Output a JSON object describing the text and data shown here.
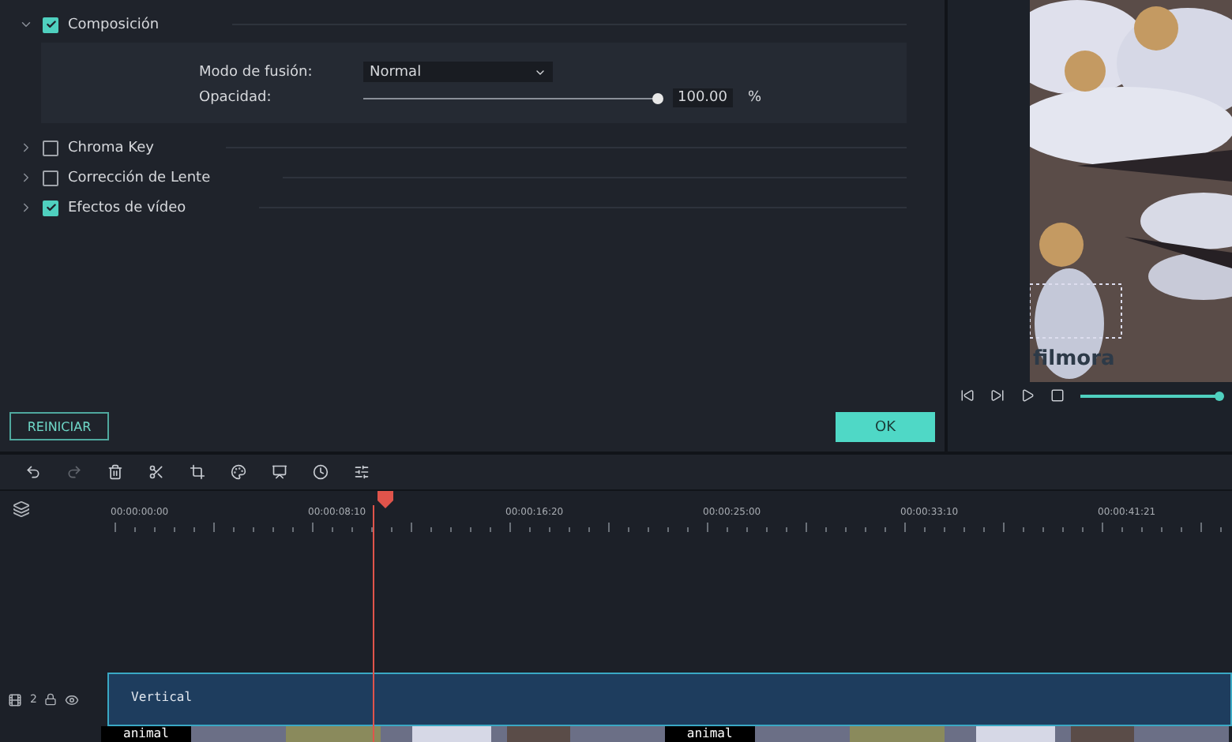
{
  "effects": [
    {
      "label": "Composición",
      "checked": true,
      "expanded": true
    },
    {
      "label": "Chroma Key",
      "checked": false,
      "expanded": false
    },
    {
      "label": "Corrección de Lente",
      "checked": false,
      "expanded": false
    },
    {
      "label": "Efectos de vídeo",
      "checked": true,
      "expanded": false
    }
  ],
  "composition": {
    "blend_label": "Modo de fusión:",
    "blend_value": "Normal",
    "opacity_label": "Opacidad:",
    "opacity": {
      "level": 1.0,
      "reading": "100.00",
      "unit": "%"
    }
  },
  "buttons": {
    "reset": "REINICIAR",
    "ok": "OK"
  },
  "preview": {
    "watermark": "filmora",
    "progress": {
      "level": 1.0
    }
  },
  "ruler": {
    "playhead": {
      "level": 0.24
    },
    "ticks": [
      "00:00:00:00",
      "00:00:08:10",
      "00:00:16:20",
      "00:00:25:00",
      "00:00:33:10",
      "00:00:41:21"
    ]
  },
  "tracks": {
    "number": "2",
    "clip_label": "Vertical",
    "media_labels": [
      "animal",
      "animal"
    ]
  }
}
